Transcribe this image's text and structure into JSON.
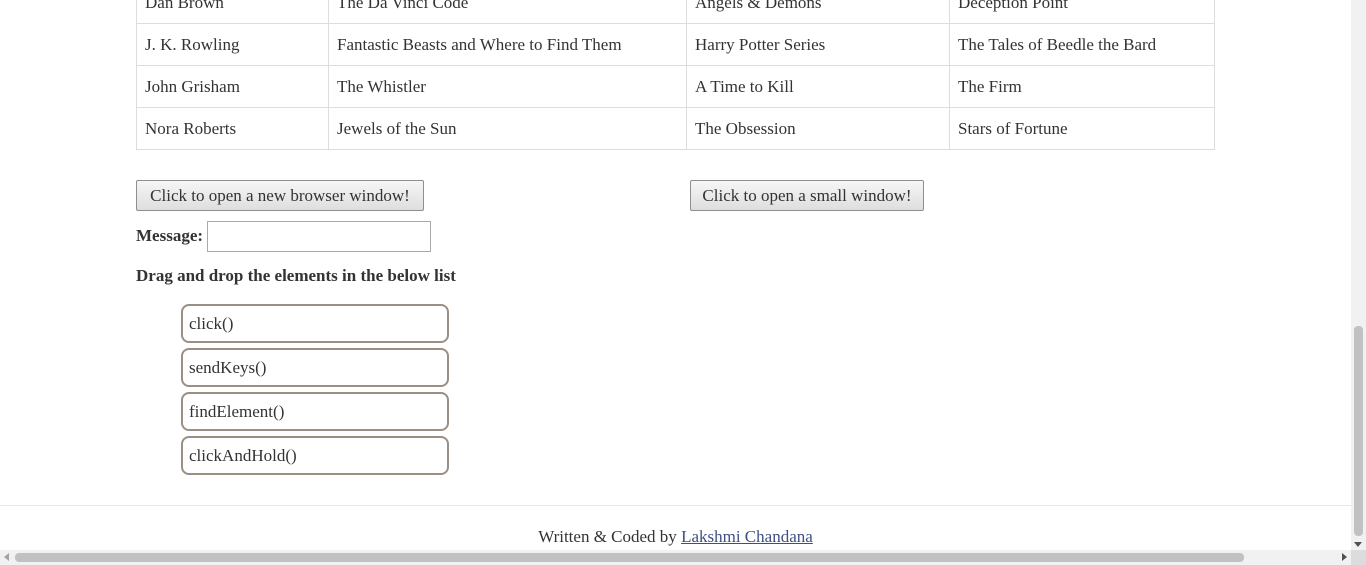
{
  "authors_table": {
    "rows": [
      [
        "Dan Brown",
        "The Da Vinci Code",
        "Angels & Demons",
        "Deception Point"
      ],
      [
        "J. K. Rowling",
        "Fantastic Beasts and Where to Find Them",
        "Harry Potter Series",
        "The Tales of Beedle the Bard"
      ],
      [
        "John Grisham",
        "The Whistler",
        "A Time to Kill",
        "The Firm"
      ],
      [
        "Nora Roberts",
        "Jewels of the Sun",
        "The Obsession",
        "Stars of Fortune"
      ]
    ]
  },
  "buttons": {
    "new_window": "Click to open a new browser window!",
    "small_window": "Click to open a small window!"
  },
  "message": {
    "label": "Message:",
    "value": ""
  },
  "drag_drop": {
    "title": "Drag and drop the elements in the below list",
    "items": [
      "click()",
      "sendKeys()",
      "findElement()",
      "clickAndHold()"
    ]
  },
  "footer": {
    "prefix": "Written & Coded by ",
    "author_link": "Lakshmi Chandana"
  }
}
